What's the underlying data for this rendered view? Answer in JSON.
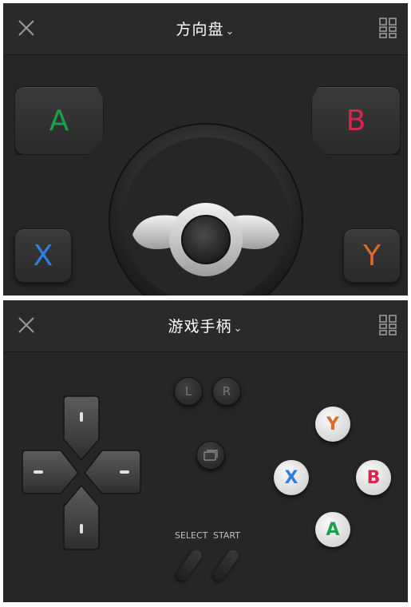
{
  "steering_panel": {
    "title": "方向盘",
    "buttons": {
      "a": "A",
      "b": "B",
      "x": "X",
      "y": "Y"
    }
  },
  "gamepad_panel": {
    "title": "游戏手柄",
    "shoulders": {
      "l": "L",
      "r": "R"
    },
    "select_label": "SELECT",
    "start_label": "START",
    "face_buttons": {
      "y": "Y",
      "x": "X",
      "b": "B",
      "a": "A"
    }
  },
  "icons": {
    "close": "close-icon",
    "layout": "grid-layout-icon",
    "dropdown": "chevron-down-icon",
    "screen_toggle": "screen-icon"
  },
  "colors": {
    "a": "#1aa24a",
    "b": "#d8264c",
    "x": "#2d7ee0",
    "y": "#e06a2a",
    "panel_bg": "#262626"
  }
}
